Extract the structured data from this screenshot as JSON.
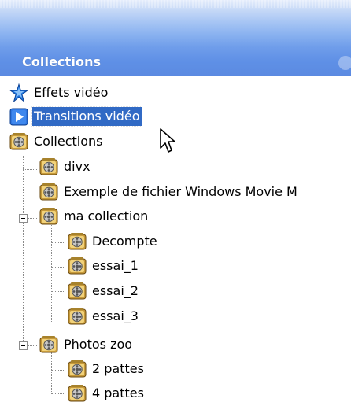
{
  "header": {
    "title": "Collections"
  },
  "tree": {
    "items": [
      {
        "label": "Effets vidéo",
        "icon": "star-effects-icon",
        "selected": false
      },
      {
        "label": "Transitions vidéo",
        "icon": "transition-play-icon",
        "selected": true
      },
      {
        "label": "Collections",
        "icon": "film-reel-icon",
        "selected": false
      },
      {
        "label": "divx",
        "icon": "film-reel-icon",
        "selected": false
      },
      {
        "label": "Exemple de fichier Windows Movie M",
        "icon": "film-reel-icon",
        "selected": false
      },
      {
        "label": "ma collection",
        "icon": "film-reel-icon",
        "expanded": true,
        "selected": false
      },
      {
        "label": "Decompte",
        "icon": "film-reel-icon",
        "selected": false
      },
      {
        "label": "essai_1",
        "icon": "film-reel-icon",
        "selected": false
      },
      {
        "label": "essai_2",
        "icon": "film-reel-icon",
        "selected": false
      },
      {
        "label": "essai_3",
        "icon": "film-reel-icon",
        "selected": false
      },
      {
        "label": "Photos zoo",
        "icon": "film-reel-icon",
        "expanded": true,
        "selected": false
      },
      {
        "label": "2 pattes",
        "icon": "film-reel-icon",
        "selected": false
      },
      {
        "label": "4 pattes",
        "icon": "film-reel-icon",
        "selected": false
      }
    ]
  },
  "colors": {
    "selection": "#316ac5",
    "header_blue": "#5b8ae1"
  }
}
